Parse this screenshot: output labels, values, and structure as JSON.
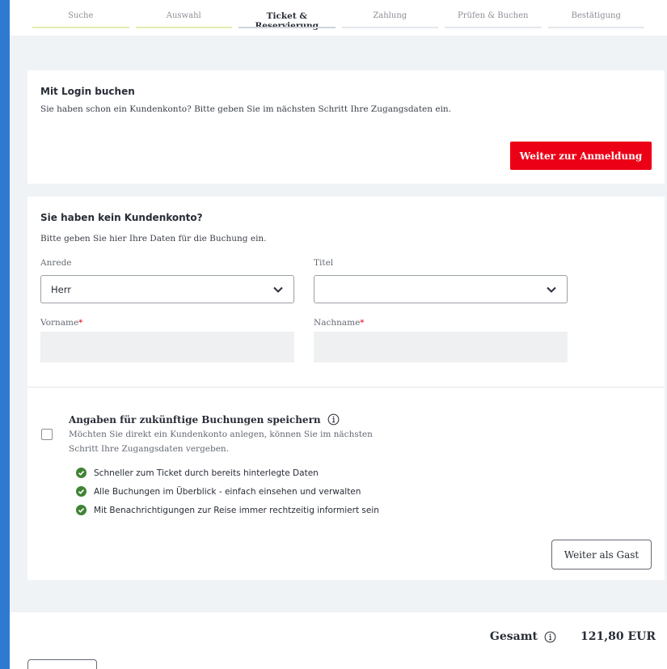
{
  "stepper": {
    "steps": [
      {
        "label": "Suche",
        "state": "done"
      },
      {
        "label": "Auswahl",
        "state": "done"
      },
      {
        "label": "Ticket & Reservierung",
        "state": "active"
      },
      {
        "label": "Zahlung",
        "state": "todo"
      },
      {
        "label": "Prüfen & Buchen",
        "state": "todo"
      },
      {
        "label": "Bestätigung",
        "state": "todo"
      }
    ]
  },
  "login": {
    "title": "Mit Login buchen",
    "text": "Sie haben schon ein Kundenkonto? Bitte geben Sie im nächsten Schritt Ihre Zugangsdaten ein.",
    "button": "Weiter zur Anmeldung"
  },
  "guest": {
    "title": "Sie haben kein Kundenkonto?",
    "text": "Bitte geben Sie hier Ihre Daten für die Buchung ein.",
    "salutation_label": "Anrede",
    "salutation_value": "Herr",
    "title_label": "Titel",
    "title_value": "",
    "firstname_label": "Vorname",
    "lastname_label": "Nachname",
    "required_mark": "*",
    "save_title": "Angaben für zukünftige Buchungen speichern",
    "save_text_1": "Möchten Sie direkt ein Kundenkonto anlegen, können Sie im nächsten",
    "save_text_2": "Schritt Ihre Zugangsdaten vergeben.",
    "benefits": [
      "Schneller zum Ticket durch bereits hinterlegte Daten",
      "Alle Buchungen im Überblick - einfach einsehen und verwalten",
      "Mit Benachrichtigungen zur Reise immer rechtzeitig informiert sein"
    ],
    "guest_button": "Weiter als Gast"
  },
  "footer": {
    "total_label": "Gesamt",
    "total_value": "121,80 EUR"
  },
  "colors": {
    "primary_red": "#ec0016",
    "check_green": "#408335",
    "frame_blue": "#2e7ad1"
  }
}
